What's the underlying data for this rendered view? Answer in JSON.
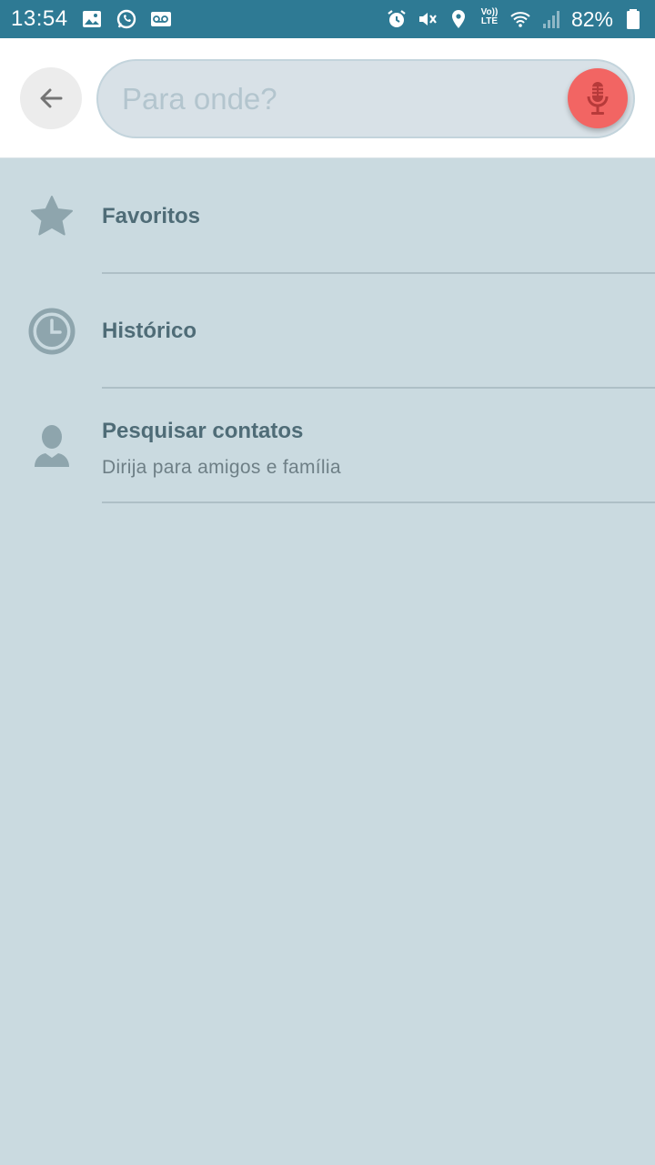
{
  "status_bar": {
    "time": "13:54",
    "battery_percent": "82%",
    "left_icons": [
      "image-icon",
      "whatsapp-icon",
      "voicemail-icon"
    ],
    "right_icons": [
      "alarm-icon",
      "mute-icon",
      "location-icon",
      "volte-icon",
      "wifi-icon",
      "signal-icon",
      "battery-icon"
    ],
    "volte_label": "Vo)) LTE"
  },
  "search": {
    "placeholder": "Para onde?",
    "value": ""
  },
  "list": {
    "items": [
      {
        "icon": "star-icon",
        "title": "Favoritos",
        "subtitle": ""
      },
      {
        "icon": "clock-icon",
        "title": "Histórico",
        "subtitle": ""
      },
      {
        "icon": "contact-icon",
        "title": "Pesquisar contatos",
        "subtitle": "Dirija para amigos e família"
      }
    ]
  },
  "colors": {
    "status_bar": "#2e7a94",
    "background": "#cadae0",
    "mic_button": "#f26563",
    "title_text": "#4f6c77"
  }
}
